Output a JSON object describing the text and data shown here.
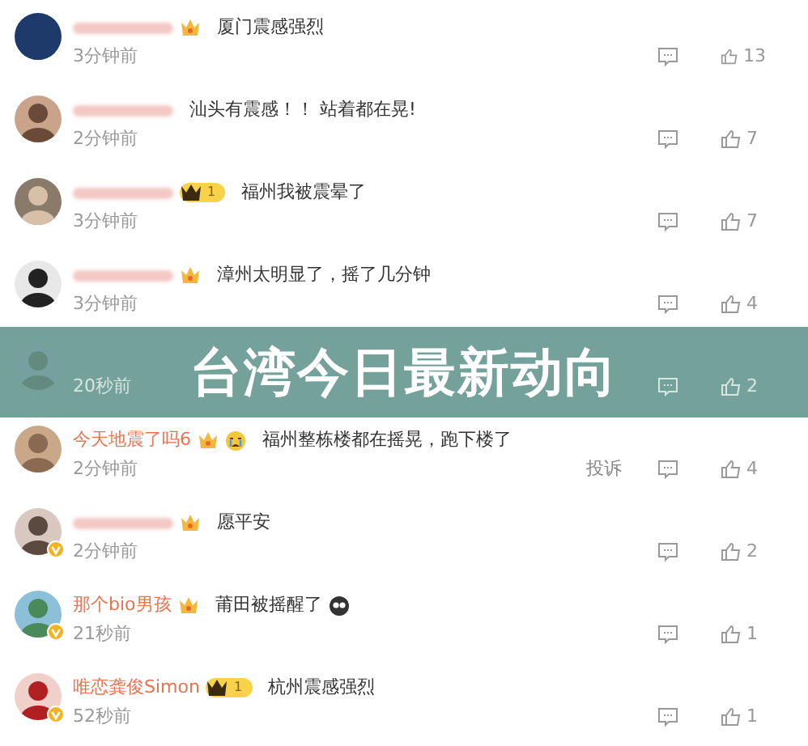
{
  "comments": [
    {
      "name_blurred": true,
      "badge": {
        "kind": "crown"
      },
      "text": "厦门震感强烈",
      "time": "3分钟前",
      "likes": "13",
      "verified": false
    },
    {
      "name_blurred": true,
      "text": "汕头有震感！！ 站着都在晃!",
      "time": "2分钟前",
      "likes": "7",
      "verified": false
    },
    {
      "name_blurred": true,
      "badge": {
        "kind": "crown-level",
        "level": "1"
      },
      "text": "福州我被震晕了",
      "time": "3分钟前",
      "likes": "7",
      "verified": false
    },
    {
      "name_blurred": true,
      "badge": {
        "kind": "crown"
      },
      "text": "漳州太明显了，摇了几分钟",
      "time": "3分钟前",
      "likes": "4",
      "verified": false
    },
    {
      "time": "20秒前",
      "likes": "2"
    },
    {
      "name": "今天地震了吗6",
      "name_blurred": false,
      "badge": {
        "kind": "crown"
      },
      "leading_emoji": true,
      "text": "福州整栋楼都在摇晃，跑下楼了",
      "time": "2分钟前",
      "likes": "4",
      "report": "投诉",
      "verified": false
    },
    {
      "name_blurred": true,
      "badge": {
        "kind": "crown"
      },
      "text": "愿平安",
      "time": "2分钟前",
      "likes": "2",
      "verified": true
    },
    {
      "name": "那个bio男孩",
      "name_blurred": false,
      "badge": {
        "kind": "crown"
      },
      "trailing_emoji": true,
      "text": "莆田被摇醒了",
      "time": "21秒前",
      "likes": "1",
      "verified": true
    },
    {
      "name": "唯恋龚俊Simon",
      "name_blurred": false,
      "badge": {
        "kind": "crown-level",
        "level": "1"
      },
      "text": "杭州震感强烈",
      "time": "52秒前",
      "likes": "1",
      "verified": true
    }
  ],
  "banner": {
    "title": "台湾今日最新动向"
  }
}
